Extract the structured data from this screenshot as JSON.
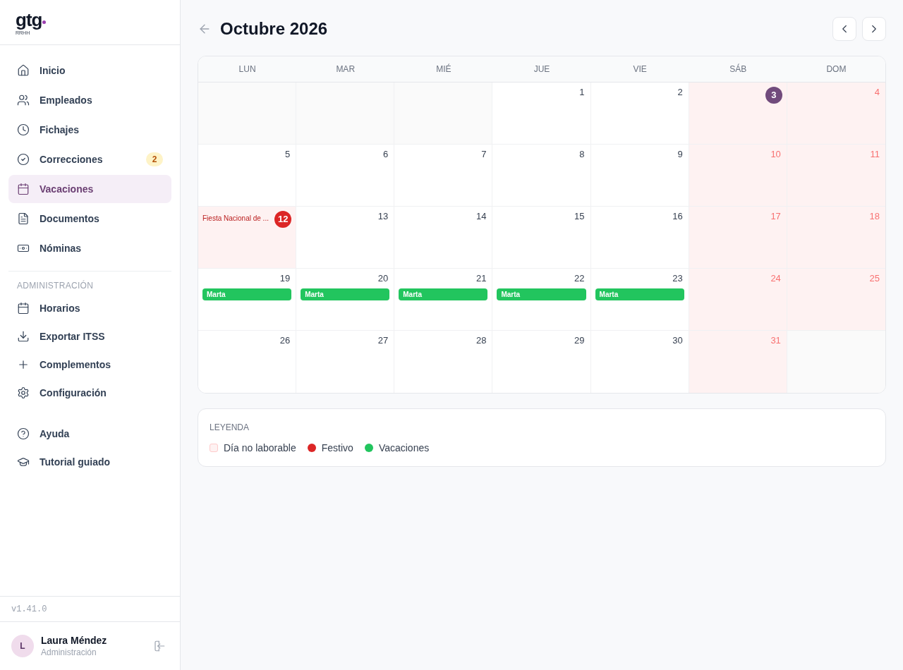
{
  "logo": {
    "wordmark": "gtg",
    "subtitle": "RRHH"
  },
  "sidebar": {
    "items": [
      {
        "label": "Inicio",
        "selected": false
      },
      {
        "label": "Empleados",
        "selected": false
      },
      {
        "label": "Fichajes",
        "selected": false
      },
      {
        "label": "Correcciones",
        "selected": false,
        "badge": "2"
      },
      {
        "label": "Vacaciones",
        "selected": true
      },
      {
        "label": "Documentos",
        "selected": false
      },
      {
        "label": "Nóminas",
        "selected": false
      }
    ],
    "admin_section": {
      "title": "ADMINISTRACIÓN",
      "items": [
        {
          "label": "Horarios",
          "selected": false
        },
        {
          "label": "Exportar ITSS",
          "selected": false
        },
        {
          "label": "Complementos",
          "selected": false
        },
        {
          "label": "Configuración",
          "selected": false
        }
      ]
    },
    "help_items": [
      {
        "label": "Ayuda",
        "selected": false
      },
      {
        "label": "Tutorial guiado",
        "selected": false
      }
    ],
    "version": "v1.41.0",
    "user": {
      "initial": "L",
      "name": "Laura Méndez",
      "role": "Administración"
    }
  },
  "header": {
    "title": "Octubre 2026"
  },
  "calendar": {
    "weekdays": [
      "LUN",
      "MAR",
      "MIÉ",
      "JUE",
      "VIE",
      "SÁB",
      "DOM"
    ],
    "weeks": [
      [
        {
          "kind": "blank"
        },
        {
          "kind": "blank"
        },
        {
          "kind": "blank"
        },
        {
          "kind": "day",
          "day": "1",
          "weekend": false,
          "today": false,
          "holiday": false
        },
        {
          "kind": "day",
          "day": "2",
          "weekend": false,
          "today": false,
          "holiday": false
        },
        {
          "kind": "day",
          "day": "3",
          "weekend": true,
          "today": true,
          "holiday": false
        },
        {
          "kind": "day",
          "day": "4",
          "weekend": true,
          "today": false,
          "holiday": false
        }
      ],
      [
        {
          "kind": "day",
          "day": "5",
          "weekend": false,
          "today": false,
          "holiday": false
        },
        {
          "kind": "day",
          "day": "6",
          "weekend": false,
          "today": false,
          "holiday": false
        },
        {
          "kind": "day",
          "day": "7",
          "weekend": false,
          "today": false,
          "holiday": false
        },
        {
          "kind": "day",
          "day": "8",
          "weekend": false,
          "today": false,
          "holiday": false
        },
        {
          "kind": "day",
          "day": "9",
          "weekend": false,
          "today": false,
          "holiday": false
        },
        {
          "kind": "day",
          "day": "10",
          "weekend": true,
          "today": false,
          "holiday": false
        },
        {
          "kind": "day",
          "day": "11",
          "weekend": true,
          "today": false,
          "holiday": false
        }
      ],
      [
        {
          "kind": "day",
          "day": "12",
          "weekend": false,
          "today": false,
          "holiday": true,
          "holiday_name": "Fiesta Nacional de ..."
        },
        {
          "kind": "day",
          "day": "13",
          "weekend": false,
          "today": false,
          "holiday": false
        },
        {
          "kind": "day",
          "day": "14",
          "weekend": false,
          "today": false,
          "holiday": false
        },
        {
          "kind": "day",
          "day": "15",
          "weekend": false,
          "today": false,
          "holiday": false
        },
        {
          "kind": "day",
          "day": "16",
          "weekend": false,
          "today": false,
          "holiday": false
        },
        {
          "kind": "day",
          "day": "17",
          "weekend": true,
          "today": false,
          "holiday": false
        },
        {
          "kind": "day",
          "day": "18",
          "weekend": true,
          "today": false,
          "holiday": false
        }
      ],
      [
        {
          "kind": "day",
          "day": "19",
          "weekend": false,
          "today": false,
          "holiday": false,
          "events": [
            {
              "kind": "vacation",
              "label": "Marta"
            }
          ]
        },
        {
          "kind": "day",
          "day": "20",
          "weekend": false,
          "today": false,
          "holiday": false,
          "events": [
            {
              "kind": "vacation",
              "label": "Marta"
            }
          ]
        },
        {
          "kind": "day",
          "day": "21",
          "weekend": false,
          "today": false,
          "holiday": false,
          "events": [
            {
              "kind": "vacation",
              "label": "Marta"
            }
          ]
        },
        {
          "kind": "day",
          "day": "22",
          "weekend": false,
          "today": false,
          "holiday": false,
          "events": [
            {
              "kind": "vacation",
              "label": "Marta"
            }
          ]
        },
        {
          "kind": "day",
          "day": "23",
          "weekend": false,
          "today": false,
          "holiday": false,
          "events": [
            {
              "kind": "vacation",
              "label": "Marta"
            }
          ]
        },
        {
          "kind": "day",
          "day": "24",
          "weekend": true,
          "today": false,
          "holiday": false
        },
        {
          "kind": "day",
          "day": "25",
          "weekend": true,
          "today": false,
          "holiday": false
        }
      ],
      [
        {
          "kind": "day",
          "day": "26",
          "weekend": false,
          "today": false,
          "holiday": false
        },
        {
          "kind": "day",
          "day": "27",
          "weekend": false,
          "today": false,
          "holiday": false
        },
        {
          "kind": "day",
          "day": "28",
          "weekend": false,
          "today": false,
          "holiday": false
        },
        {
          "kind": "day",
          "day": "29",
          "weekend": false,
          "today": false,
          "holiday": false
        },
        {
          "kind": "day",
          "day": "30",
          "weekend": false,
          "today": false,
          "holiday": false
        },
        {
          "kind": "day",
          "day": "31",
          "weekend": true,
          "today": false,
          "holiday": false
        },
        {
          "kind": "blank"
        }
      ]
    ]
  },
  "legend": {
    "title": "LEYENDA",
    "items": [
      {
        "kind": "swatch",
        "label": "Día no laborable",
        "color": "#fef2f2"
      },
      {
        "kind": "dot",
        "label": "Festivo",
        "color": "#dc2626"
      },
      {
        "kind": "dot",
        "label": "Vacaciones",
        "color": "#22c55e"
      }
    ]
  }
}
